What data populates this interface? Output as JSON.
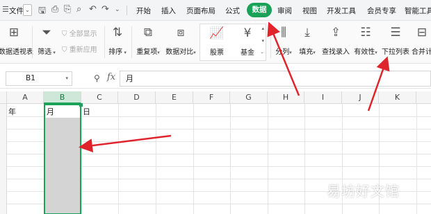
{
  "menubar": {
    "file_label": "文件",
    "tabs": [
      "开始",
      "插入",
      "页面布局",
      "公式",
      "数据",
      "审阅",
      "视图",
      "开发工具",
      "会员专享",
      "智能工具"
    ],
    "active_tab": "数据"
  },
  "ribbon": {
    "pivot_label": "数据透视表",
    "filter_label": "筛选",
    "show_all_label": "全部显示",
    "reapply_label": "重新应用",
    "sort_label": "排序",
    "duplicates_label": "重复项",
    "compare_label": "数据对比",
    "stock_label": "股票",
    "fund_label": "基金",
    "split_label": "分列",
    "fill_label": "填充",
    "lookup_label": "查找录入",
    "validity_label": "有效性",
    "dropdown_list_label": "下拉列表",
    "consolidate_label": "合并计"
  },
  "formula_bar": {
    "cell_ref": "B1",
    "fx_label": "fx",
    "content": "月"
  },
  "sheet": {
    "columns": [
      "A",
      "B",
      "C",
      "D",
      "E",
      "F",
      "G",
      "H",
      "I",
      "J",
      "K"
    ],
    "selected_column": "B",
    "cells": {
      "A1": "年",
      "B1": "月",
      "C1": "日"
    }
  },
  "watermark": "易坊好文馆",
  "colors": {
    "accent": "#1aa259",
    "arrow": "#e0242b",
    "selection_fill": "#d4d4d4"
  }
}
